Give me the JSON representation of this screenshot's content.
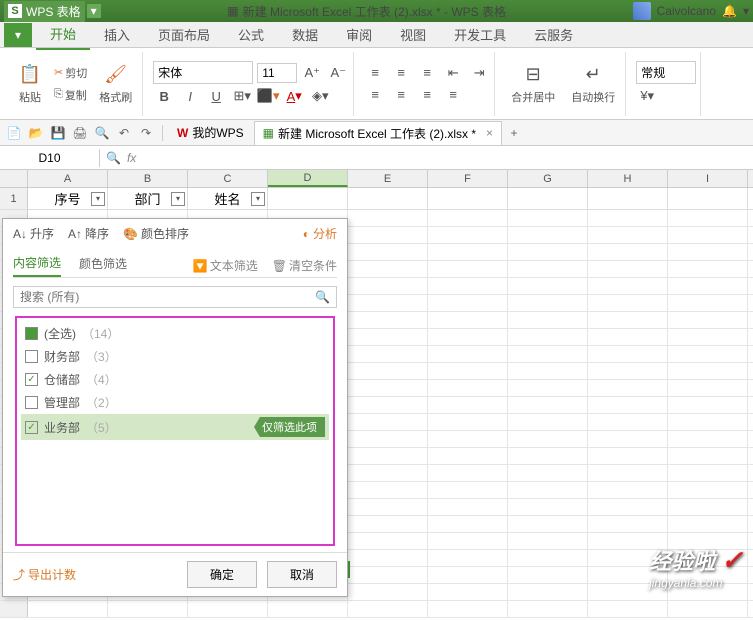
{
  "app": {
    "brand": "WPS 表格",
    "doc_icon": "▦",
    "doc_title": "新建 Microsoft Excel 工作表 (2).xlsx * - WPS 表格",
    "user": "Caivolcano"
  },
  "menu": {
    "tabs": [
      "开始",
      "插入",
      "页面布局",
      "公式",
      "数据",
      "审阅",
      "视图",
      "开发工具",
      "云服务"
    ]
  },
  "ribbon": {
    "paste": "粘贴",
    "cut": "剪切",
    "copy": "复制",
    "format_painter": "格式刷",
    "font_name": "宋体",
    "font_size": "11",
    "merge": "合并居中",
    "wrap": "自动换行",
    "number_format": "常规"
  },
  "quickbar": {
    "mywps": "我的WPS",
    "doc_tab": "新建 Microsoft Excel 工作表 (2).xlsx *"
  },
  "formula": {
    "namebox": "D10",
    "fx": "fx"
  },
  "columns": [
    "A",
    "B",
    "C",
    "D",
    "E",
    "F",
    "G",
    "H",
    "I"
  ],
  "row1": {
    "num": "1",
    "A": "序号",
    "B": "部门",
    "C": "姓名"
  },
  "filter": {
    "sort_asc": "升序",
    "sort_desc": "降序",
    "sort_color": "颜色排序",
    "analysis": "分析",
    "tab_content": "内容筛选",
    "tab_color": "颜色筛选",
    "text_filter": "文本筛选",
    "clear": "清空条件",
    "search_placeholder": "搜索 (所有)",
    "items": [
      {
        "label": "(全选)",
        "count": "（14）",
        "state": "partial"
      },
      {
        "label": "财务部",
        "count": "（3）",
        "state": "unchecked"
      },
      {
        "label": "仓储部",
        "count": "（4）",
        "state": "checked"
      },
      {
        "label": "管理部",
        "count": "（2）",
        "state": "unchecked"
      },
      {
        "label": "业务部",
        "count": "（5）",
        "state": "checked"
      }
    ],
    "only_this": "仅筛选此项",
    "export": "导出计数",
    "ok": "确定",
    "cancel": "取消"
  },
  "watermark": {
    "main": "经验啦",
    "sub": "jingyanla.com"
  }
}
